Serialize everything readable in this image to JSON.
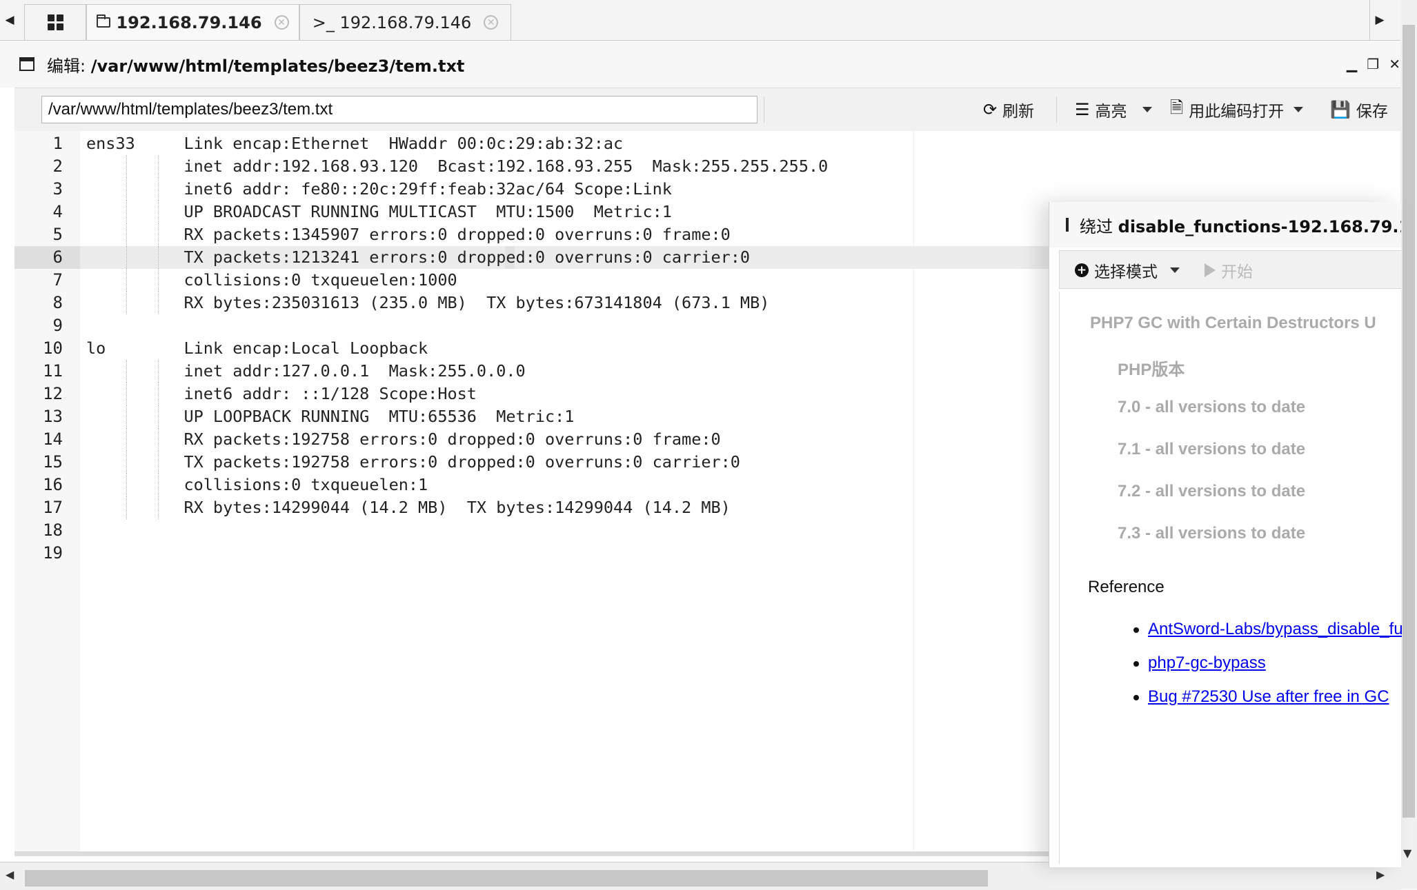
{
  "tabs": [
    {
      "label": "",
      "icon": "grid-icon"
    },
    {
      "label": "192.168.79.146",
      "icon": "folder-icon",
      "active": true
    },
    {
      "label": ">_ 192.168.79.146",
      "icon": "terminal-icon"
    }
  ],
  "window": {
    "title_prefix": "编辑: ",
    "title_path": "/var/www/html/templates/beez3/tem.txt"
  },
  "toolbar": {
    "path_value": "/var/www/html/templates/beez3/tem.txt",
    "refresh_label": "刷新",
    "highlight_label": "高亮",
    "encoding_label": "用此编码打开",
    "save_label": "保存"
  },
  "editor": {
    "highlighted_line": 6,
    "lines": [
      {
        "n": "1",
        "text": "ens33     Link encap:Ethernet  HWaddr 00:0c:29:ab:32:ac"
      },
      {
        "n": "2",
        "text": "          inet addr:192.168.93.120  Bcast:192.168.93.255  Mask:255.255.255.0"
      },
      {
        "n": "3",
        "text": "          inet6 addr: fe80::20c:29ff:feab:32ac/64 Scope:Link"
      },
      {
        "n": "4",
        "text": "          UP BROADCAST RUNNING MULTICAST  MTU:1500  Metric:1"
      },
      {
        "n": "5",
        "text": "          RX packets:1345907 errors:0 dropped:0 overruns:0 frame:0"
      },
      {
        "n": "6",
        "text": "          TX packets:1213241 errors:0 dropped:0 overruns:0 carrier:0"
      },
      {
        "n": "7",
        "text": "          collisions:0 txqueuelen:1000"
      },
      {
        "n": "8",
        "text": "          RX bytes:235031613 (235.0 MB)  TX bytes:673141804 (673.1 MB)"
      },
      {
        "n": "9",
        "text": ""
      },
      {
        "n": "10",
        "text": "lo        Link encap:Local Loopback"
      },
      {
        "n": "11",
        "text": "          inet addr:127.0.0.1  Mask:255.0.0.0"
      },
      {
        "n": "12",
        "text": "          inet6 addr: ::1/128 Scope:Host"
      },
      {
        "n": "13",
        "text": "          UP LOOPBACK RUNNING  MTU:65536  Metric:1"
      },
      {
        "n": "14",
        "text": "          RX packets:192758 errors:0 dropped:0 overruns:0 frame:0"
      },
      {
        "n": "15",
        "text": "          TX packets:192758 errors:0 dropped:0 overruns:0 carrier:0"
      },
      {
        "n": "16",
        "text": "          collisions:0 txqueuelen:1"
      },
      {
        "n": "17",
        "text": "          RX bytes:14299044 (14.2 MB)  TX bytes:14299044 (14.2 MB)"
      },
      {
        "n": "18",
        "text": ""
      },
      {
        "n": "19",
        "text": ""
      }
    ]
  },
  "panel": {
    "title_prefix": "绕过 ",
    "title_bold": "disable_functions-192.168.79.1",
    "mode_label": "选择模式",
    "start_label": "开始",
    "heading": "PHP7 GC with Certain Destructors U",
    "version_label": "PHP版本",
    "versions": [
      "7.0 - all versions to date",
      "7.1 - all versions to date",
      "7.2 - all versions to date",
      "7.3 - all versions to date"
    ],
    "reference_label": "Reference",
    "links": [
      "AntSword-Labs/bypass_disable_fu",
      "php7-gc-bypass",
      "Bug #72530 Use after free in GC"
    ]
  }
}
